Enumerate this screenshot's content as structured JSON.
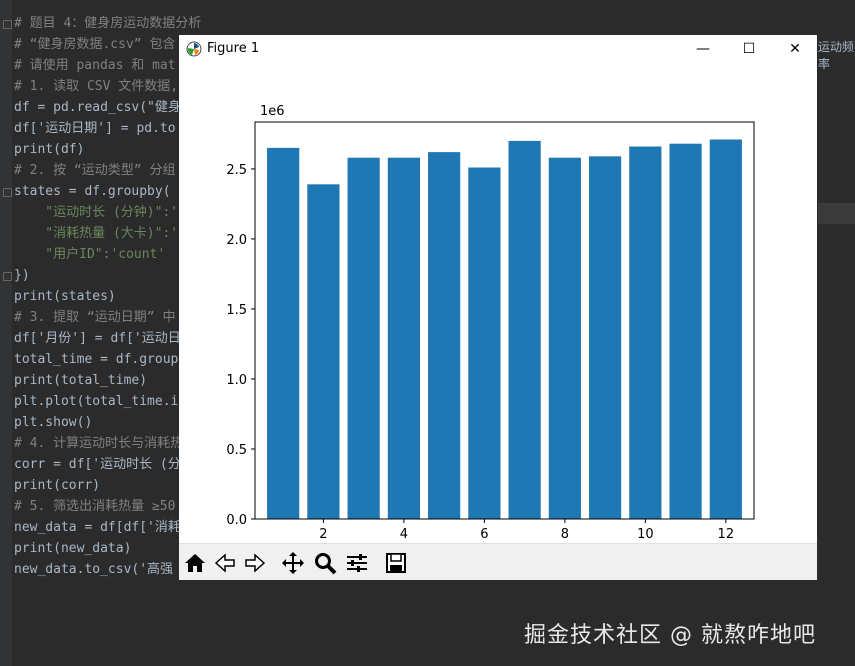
{
  "editor": {
    "lines": [
      {
        "text": "# 题目 4：健身房运动数据分析",
        "kind": "comment"
      },
      {
        "text": "# “健身房数据.csv” 包含",
        "kind": "comment"
      },
      {
        "text": "# 请使用 pandas 和 mat",
        "kind": "comment"
      },
      {
        "text": "# 1. 读取 CSV 文件数据,",
        "kind": "comment"
      },
      {
        "text": "df = pd.read_csv(\"健身",
        "kind": "code"
      },
      {
        "text": "df['运动日期'] = pd.to",
        "kind": "code"
      },
      {
        "text": "print(df)",
        "kind": "code"
      },
      {
        "text": "# 2. 按 “运动类型” 分组",
        "kind": "comment"
      },
      {
        "text": "states = df.groupby(",
        "kind": "code"
      },
      {
        "text": "    \"运动时长 (分钟)\":'",
        "kind": "str"
      },
      {
        "text": "    \"消耗热量 (大卡)\":'",
        "kind": "str"
      },
      {
        "text": "    \"用户ID\":'count'",
        "kind": "str"
      },
      {
        "text": "})",
        "kind": "code"
      },
      {
        "text": "print(states)",
        "kind": "code"
      },
      {
        "text": "# 3. 提取 “运动日期” 中",
        "kind": "comment"
      },
      {
        "text": "df['月份'] = df['运动日",
        "kind": "code"
      },
      {
        "text": "total_time = df.group",
        "kind": "code"
      },
      {
        "text": "print(total_time)",
        "kind": "code"
      },
      {
        "text": "plt.plot(total_time.i",
        "kind": "code"
      },
      {
        "text": "plt.show()",
        "kind": "code"
      },
      {
        "text": "# 4. 计算运动时长与消耗热",
        "kind": "comment"
      },
      {
        "text": "corr = df['运动时长 (分",
        "kind": "code"
      },
      {
        "text": "print(corr)",
        "kind": "code"
      },
      {
        "text": "# 5. 筛选出消耗热量 ≥50",
        "kind": "comment"
      },
      {
        "text": "new_data = df[df['消耗",
        "kind": "code"
      },
      {
        "text": "print(new_data)",
        "kind": "code"
      },
      {
        "text": "new_data.to_csv('高强",
        "kind": "code"
      }
    ],
    "right_overflow_text": "运动频率"
  },
  "figure": {
    "title": "Figure 1",
    "icon": "matplotlib-icon",
    "controls": {
      "minimize": "—",
      "maximize": "☐",
      "close": "✕"
    }
  },
  "chart_data": {
    "type": "bar",
    "categories": [
      1,
      2,
      3,
      4,
      5,
      6,
      7,
      8,
      9,
      10,
      11,
      12
    ],
    "values": [
      2650000,
      2390000,
      2580000,
      2580000,
      2620000,
      2510000,
      2700000,
      2580000,
      2590000,
      2660000,
      2680000,
      2710000
    ],
    "offset_label": "1e6",
    "xticks": [
      2,
      4,
      6,
      8,
      10,
      12
    ],
    "yticks": [
      0.0,
      0.5,
      1.0,
      1.5,
      2.0,
      2.5
    ],
    "ylim": [
      0,
      2835000
    ],
    "xlim": [
      0.3,
      12.7
    ],
    "bar_color": "#1f77b4",
    "title": "",
    "xlabel": "",
    "ylabel": ""
  },
  "toolbar": {
    "buttons": [
      "home-icon",
      "back-icon",
      "forward-icon",
      "pan-icon",
      "zoom-icon",
      "configure-subplots-icon",
      "save-icon"
    ]
  },
  "watermark": "掘金技术社区 @ 就熬咋地吧"
}
